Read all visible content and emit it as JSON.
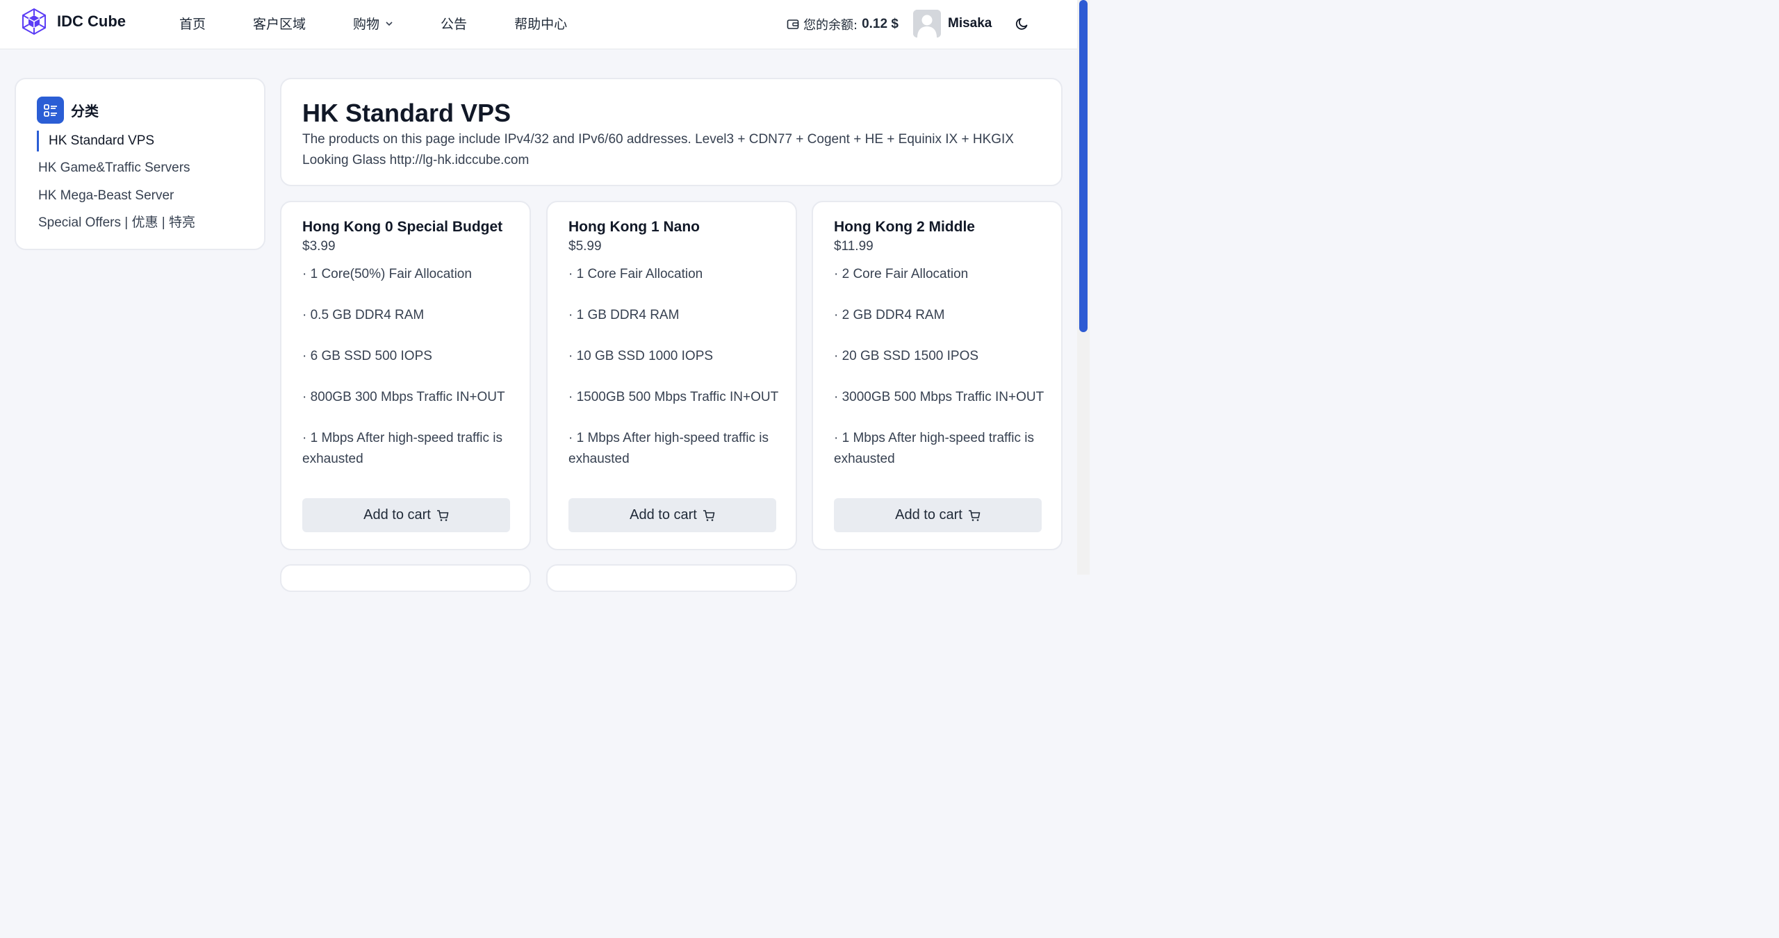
{
  "header": {
    "brand": "IDC Cube",
    "nav": [
      {
        "label": "首页"
      },
      {
        "label": "客户区域"
      },
      {
        "label": "购物"
      },
      {
        "label": "公告"
      },
      {
        "label": "帮助中心"
      }
    ],
    "balance_label": "您的余额:",
    "balance_value": "0.12 $",
    "username": "Misaka"
  },
  "sidebar": {
    "title": "分类",
    "items": [
      {
        "label": "HK Standard VPS",
        "active": true
      },
      {
        "label": "HK Game&Traffic Servers"
      },
      {
        "label": "HK Mega-Beast Server"
      },
      {
        "label": "Special Offers | 优惠 | 特亮"
      }
    ]
  },
  "hero": {
    "title": "HK Standard VPS",
    "description_line1": "The products on this page include IPv4/32 and IPv6/60 addresses. Level3 + CDN77 + Cogent + HE + Equinix IX + HKGIX",
    "description_line2": "Looking Glass http://lg-hk.idccube.com"
  },
  "products": [
    {
      "name": "Hong Kong 0 Special Budget",
      "price": "$3.99",
      "features": [
        "· 1 Core(50%) Fair Allocation",
        "· 0.5 GB DDR4 RAM",
        "· 6 GB SSD 500 IOPS",
        "· 800GB 300 Mbps Traffic IN+OUT",
        "· 1 Mbps After high-speed traffic is exhausted"
      ],
      "button": "Add to cart"
    },
    {
      "name": "Hong Kong 1 Nano",
      "price": "$5.99",
      "features": [
        "· 1 Core Fair Allocation",
        "· 1 GB DDR4 RAM",
        "· 10 GB SSD 1000 IOPS",
        "· 1500GB 500 Mbps Traffic IN+OUT",
        "· 1 Mbps After high-speed traffic is exhausted"
      ],
      "button": "Add to cart"
    },
    {
      "name": "Hong Kong 2 Middle",
      "price": "$11.99",
      "features": [
        "· 2 Core Fair Allocation",
        "· 2 GB DDR4 RAM",
        "· 20 GB SSD 1500 IPOS",
        "· 3000GB 500 Mbps Traffic IN+OUT",
        "· 1 Mbps After high-speed traffic is exhausted"
      ],
      "button": "Add to cart"
    }
  ],
  "colors": {
    "accent": "#2b5ed5",
    "logo": "#5b3df5",
    "button_bg": "#e9ecf1",
    "page_bg": "#f5f6fa"
  },
  "icons": {
    "logo": "cube-logo-icon",
    "nav_dropdown": "chevron-down-icon",
    "wallet": "wallet-icon",
    "theme": "moon-icon",
    "category": "list-icon",
    "cart": "cart-icon"
  }
}
